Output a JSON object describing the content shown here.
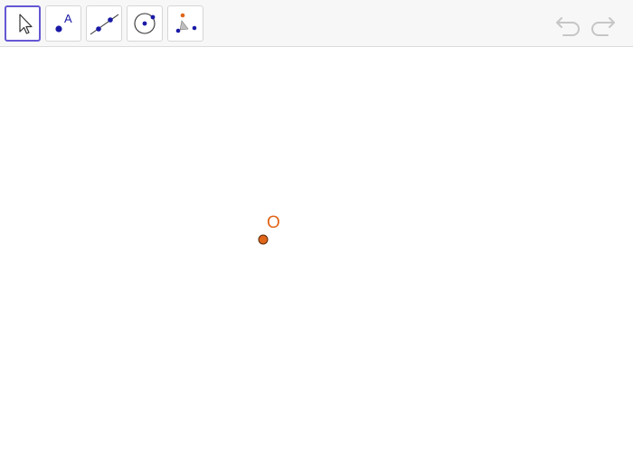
{
  "toolbar": {
    "tools": [
      {
        "name": "move",
        "icon": "arrow-cursor-icon",
        "selected": true
      },
      {
        "name": "point",
        "icon": "point-icon",
        "label": "A"
      },
      {
        "name": "line",
        "icon": "line-through-two-points-icon"
      },
      {
        "name": "circle",
        "icon": "circle-with-center-icon"
      },
      {
        "name": "angle",
        "icon": "angle-icon"
      }
    ],
    "undo_icon": "undo-icon",
    "redo_icon": "redo-icon"
  },
  "canvas": {
    "points": [
      {
        "label": "O",
        "color": "#e0661a"
      }
    ]
  },
  "colors": {
    "accent": "#6557d2",
    "tool_blue": "#1a1aa6",
    "point_orange": "#e0661a",
    "point_outline": "#5a2a0a"
  }
}
